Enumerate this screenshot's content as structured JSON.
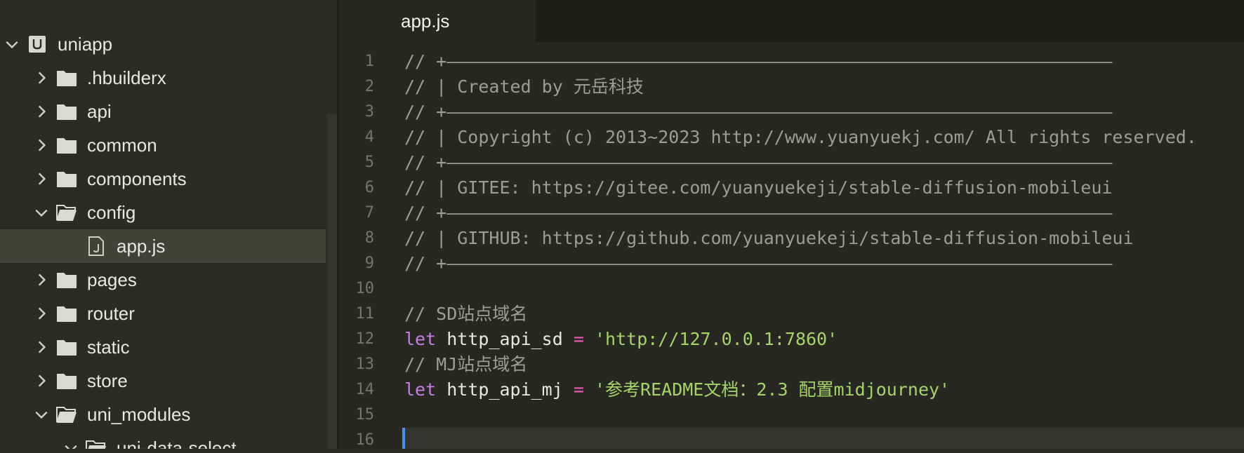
{
  "sidebar": {
    "items": [
      {
        "label": "uniapp",
        "kind": "project",
        "state": "expanded",
        "icon": "project-icon"
      },
      {
        "label": ".hbuilderx",
        "kind": "folder",
        "state": "collapsed",
        "icon": "folder-icon"
      },
      {
        "label": "api",
        "kind": "folder",
        "state": "collapsed",
        "icon": "folder-icon"
      },
      {
        "label": "common",
        "kind": "folder",
        "state": "collapsed",
        "icon": "folder-icon"
      },
      {
        "label": "components",
        "kind": "folder",
        "state": "collapsed",
        "icon": "folder-icon"
      },
      {
        "label": "config",
        "kind": "folder",
        "state": "expanded",
        "icon": "folder-open-icon"
      },
      {
        "label": "app.js",
        "kind": "file",
        "state": "selected",
        "icon": "js-file-icon"
      },
      {
        "label": "pages",
        "kind": "folder",
        "state": "collapsed",
        "icon": "folder-icon"
      },
      {
        "label": "router",
        "kind": "folder",
        "state": "collapsed",
        "icon": "folder-icon"
      },
      {
        "label": "static",
        "kind": "folder",
        "state": "collapsed",
        "icon": "folder-icon"
      },
      {
        "label": "store",
        "kind": "folder",
        "state": "collapsed",
        "icon": "folder-icon"
      },
      {
        "label": "uni_modules",
        "kind": "folder",
        "state": "expanded",
        "icon": "folder-open-icon"
      },
      {
        "label": "uni-data-select",
        "kind": "folder",
        "state": "expanded",
        "icon": "folder-open-icon"
      }
    ]
  },
  "editor": {
    "tab": {
      "label": "app.js"
    },
    "lines": [
      {
        "num": "1",
        "text": "// +———————————————————————————————————————————————————————————————"
      },
      {
        "num": "2",
        "text": "// | Created by 元岳科技"
      },
      {
        "num": "3",
        "text": "// +———————————————————————————————————————————————————————————————"
      },
      {
        "num": "4",
        "text": "// | Copyright (c) 2013~2023 http://www.yuanyuekj.com/ All rights reserved."
      },
      {
        "num": "5",
        "text": "// +———————————————————————————————————————————————————————————————"
      },
      {
        "num": "6",
        "text": "// | GITEE: https://gitee.com/yuanyuekeji/stable-diffusion-mobileui"
      },
      {
        "num": "7",
        "text": "// +———————————————————————————————————————————————————————————————"
      },
      {
        "num": "8",
        "text": "// | GITHUB: https://github.com/yuanyuekeji/stable-diffusion-mobileui"
      },
      {
        "num": "9",
        "text": "// +———————————————————————————————————————————————————————————————"
      },
      {
        "num": "10",
        "text": ""
      },
      {
        "num": "11",
        "text": "// SD站点域名"
      },
      {
        "num": "12",
        "kw": "let",
        "var": "http_api_sd",
        "op": "=",
        "str": "'http://127.0.0.1:7860'"
      },
      {
        "num": "13",
        "text": "// MJ站点域名"
      },
      {
        "num": "14",
        "kw": "let",
        "var": "http_api_mj",
        "op": "=",
        "str": "'参考README文档：2.3 配置midjourney'"
      },
      {
        "num": "15",
        "text": ""
      },
      {
        "num": "16",
        "text": ""
      }
    ]
  },
  "colors": {
    "sidebar_bg": "#2b2c27",
    "editor_bg": "#272822",
    "comment": "#9d9d95",
    "keyword": "#c77ee0",
    "operator": "#e85ab4",
    "string": "#a6d46b",
    "cursor_line_marker": "#4d8ff0"
  }
}
